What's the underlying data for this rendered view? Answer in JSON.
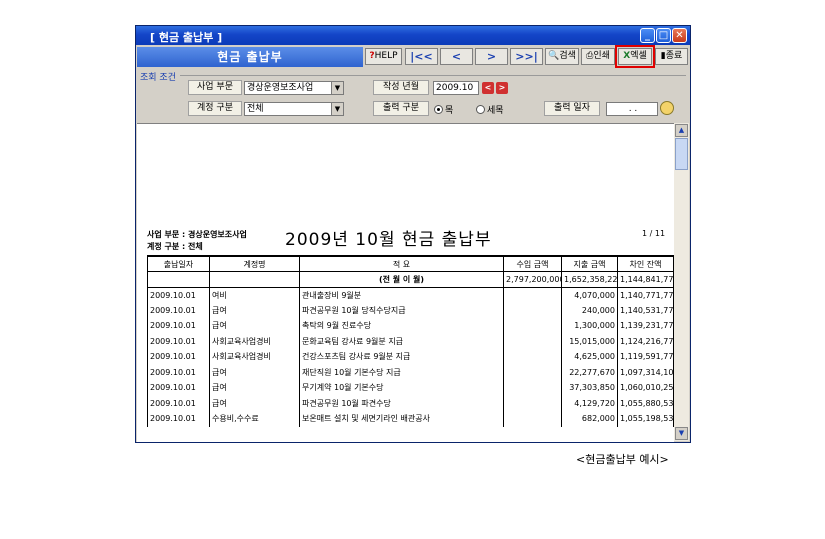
{
  "window": {
    "title": "[ 현금 출납부 ]"
  },
  "toolbar": {
    "form_title": "현금 출납부",
    "help": "HELP",
    "first": "|<<",
    "prev": "<",
    "next": ">",
    "last": ">>|",
    "search": "검색",
    "print": "인쇄",
    "excel": "엑셀",
    "close": "종료"
  },
  "conditions": {
    "section_label": "조회 조건",
    "dept_label": "사업 부문",
    "dept_value": "경상운영보조사업",
    "date_label": "작성 년월",
    "date_value": "2009.10",
    "acct_label": "계정 구분",
    "acct_value": "전체",
    "output_label": "출력 구분",
    "radio_1": "목",
    "radio_2": "세목",
    "print_date_label": "출력 일자",
    "print_date_value": ". ."
  },
  "report": {
    "title": "2009년 10월 현금 출납부",
    "dept_line": "사업 부문 : 경상운영보조사업",
    "acct_line": "계정 구분 : 전체",
    "page": "1 / 11",
    "headers": [
      "출납일자",
      "계정명",
      "적 요",
      "수입 금액",
      "지출 금액",
      "차인 잔액"
    ],
    "carry": {
      "label": "(전 월 이 월)",
      "income": "2,797,200,000",
      "expense": "1,652,358,228",
      "balance": "1,144,841,772"
    },
    "rows": [
      {
        "date": "2009.10.01",
        "account": "여비",
        "desc": "관내출장비 9월분",
        "income": "",
        "expense": "4,070,000",
        "balance": "1,140,771,772"
      },
      {
        "date": "2009.10.01",
        "account": "급여",
        "desc": "파견공무원 10월 당직수당지급",
        "income": "",
        "expense": "240,000",
        "balance": "1,140,531,772"
      },
      {
        "date": "2009.10.01",
        "account": "급여",
        "desc": "촉탁의 9월 진료수당",
        "income": "",
        "expense": "1,300,000",
        "balance": "1,139,231,772"
      },
      {
        "date": "2009.10.01",
        "account": "사회교육사업경비",
        "desc": "문화교육팀 강사료 9월분 지급",
        "income": "",
        "expense": "15,015,000",
        "balance": "1,124,216,772"
      },
      {
        "date": "2009.10.01",
        "account": "사회교육사업경비",
        "desc": "건강스포츠팀 강사료 9월분 지급",
        "income": "",
        "expense": "4,625,000",
        "balance": "1,119,591,772"
      },
      {
        "date": "2009.10.01",
        "account": "급여",
        "desc": "재단직원 10월 기본수당 지급",
        "income": "",
        "expense": "22,277,670",
        "balance": "1,097,314,102"
      },
      {
        "date": "2009.10.01",
        "account": "급여",
        "desc": "무기계약 10월 기본수당",
        "income": "",
        "expense": "37,303,850",
        "balance": "1,060,010,252"
      },
      {
        "date": "2009.10.01",
        "account": "급여",
        "desc": "파견공무원 10월 파견수당",
        "income": "",
        "expense": "4,129,720",
        "balance": "1,055,880,532"
      },
      {
        "date": "2009.10.01",
        "account": "수용비,수수료",
        "desc": "보온매트 설치 및 세면기라인 배관공사",
        "income": "",
        "expense": "682,000",
        "balance": "1,055,198,532"
      }
    ]
  },
  "caption": "<현금출납부 예시>",
  "colors": {
    "title_bar": "#1445c8",
    "form_title": "#2f63cf",
    "highlight": "#e00000"
  }
}
